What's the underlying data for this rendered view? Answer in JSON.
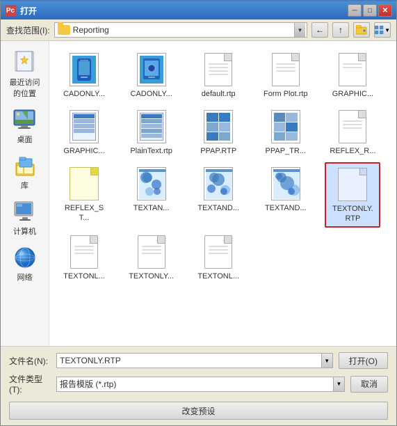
{
  "window": {
    "title": "打开",
    "icon": "Pc"
  },
  "toolbar": {
    "label": "查找范围(I):",
    "folder_name": "Reporting",
    "btns": [
      "back",
      "up",
      "new-folder",
      "views"
    ]
  },
  "sidebar": {
    "items": [
      {
        "id": "recent",
        "label": "最近访问的位置",
        "icon": "recent"
      },
      {
        "id": "desktop",
        "label": "桌面",
        "icon": "desktop"
      },
      {
        "id": "library",
        "label": "库",
        "icon": "library"
      },
      {
        "id": "computer",
        "label": "计算机",
        "icon": "computer"
      },
      {
        "id": "network",
        "label": "网络",
        "icon": "network"
      }
    ]
  },
  "files": [
    {
      "name": "CADONLY...",
      "type": "cad",
      "selected": false
    },
    {
      "name": "CADONLY...",
      "type": "cad2",
      "selected": false
    },
    {
      "name": "default.rtp",
      "type": "page",
      "selected": false
    },
    {
      "name": "Form Plot.rtp",
      "type": "page",
      "selected": false
    },
    {
      "name": "GRAPHIC...",
      "type": "page",
      "selected": false
    },
    {
      "name": "GRAPHIC...",
      "type": "table",
      "selected": false
    },
    {
      "name": "PlainText.rtp",
      "type": "table",
      "selected": false
    },
    {
      "name": "PPAP.RTP",
      "type": "ppap",
      "selected": false
    },
    {
      "name": "PPAP_TR...",
      "type": "ppap",
      "selected": false
    },
    {
      "name": "REFLEX_R...",
      "type": "page",
      "selected": false
    },
    {
      "name": "REFLEX_ST...",
      "type": "blank",
      "selected": false
    },
    {
      "name": "TEXTAN...",
      "type": "blue-pattern",
      "selected": false
    },
    {
      "name": "TEXTAND...",
      "type": "blue-pattern",
      "selected": false
    },
    {
      "name": "TEXTAND...",
      "type": "blue-pattern",
      "selected": false
    },
    {
      "name": "TEXTONLY.\nRTP",
      "type": "selected-blue",
      "selected": true
    },
    {
      "name": "TEXTONL...",
      "type": "page",
      "selected": false
    },
    {
      "name": "TEXTONLY...",
      "type": "page",
      "selected": false
    },
    {
      "name": "TEXTONL...",
      "type": "page",
      "selected": false
    }
  ],
  "bottom": {
    "filename_label": "文件名(N):",
    "filename_value": "TEXTONLY.RTP",
    "filetype_label": "文件类型(T):",
    "filetype_value": "报告模版 (*.rtp)",
    "open_btn": "打开(O)",
    "cancel_btn": "取消",
    "preset_btn": "改变预设"
  }
}
